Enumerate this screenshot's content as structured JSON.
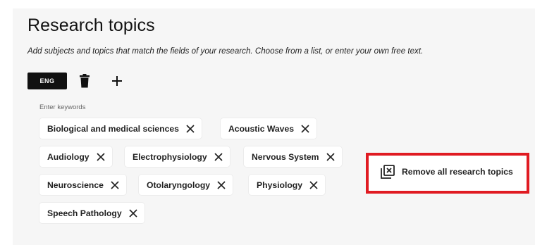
{
  "section": {
    "title": "Research topics",
    "subtitle": "Add subjects and topics that match the fields of your research. Choose from a list, or enter your own free text."
  },
  "toolbar": {
    "language_label": "ENG",
    "delete_icon": "trash-icon",
    "add_icon": "plus-icon"
  },
  "keywords": {
    "label": "Enter keywords",
    "chips": [
      "Biological and medical sciences",
      "Acoustic Waves",
      "Audiology",
      "Electrophysiology",
      "Nervous System",
      "Neuroscience",
      "Otolaryngology",
      "Physiology",
      "Speech Pathology"
    ]
  },
  "remove_all": {
    "label": "Remove all research topics",
    "icon": "remove-all-icon",
    "highlight_color": "#e01b22"
  }
}
